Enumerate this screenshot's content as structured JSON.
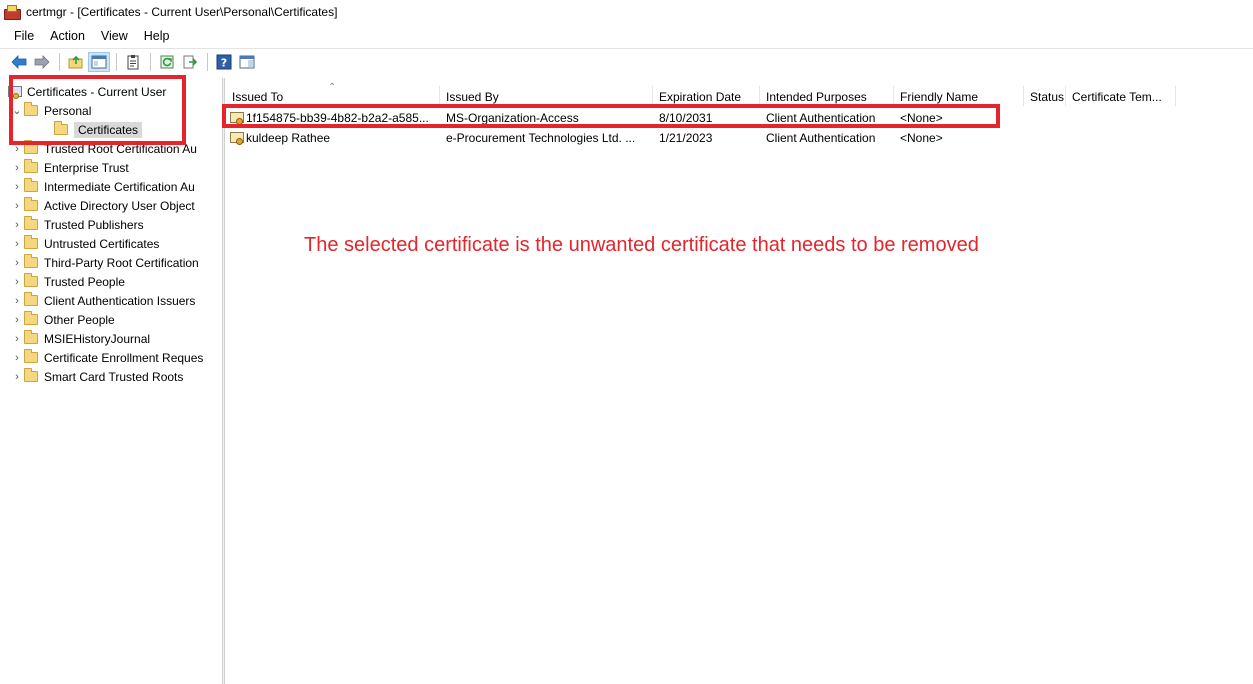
{
  "window": {
    "title": "certmgr - [Certificates - Current User\\Personal\\Certificates]"
  },
  "menu": [
    "File",
    "Action",
    "View",
    "Help"
  ],
  "toolbar": {
    "buttons": [
      "back-icon",
      "forward-icon",
      "up-folder-icon",
      "show-hide-tree-icon",
      "properties-icon",
      "refresh-icon",
      "export-list-icon",
      "help-icon",
      "action-pane-icon"
    ]
  },
  "tree": {
    "root": "Certificates - Current User",
    "items": [
      {
        "label": "Personal",
        "expanded": true
      },
      {
        "label": "Certificates",
        "selected": true
      },
      {
        "label": "Trusted Root Certification Au"
      },
      {
        "label": "Enterprise Trust"
      },
      {
        "label": "Intermediate Certification Au"
      },
      {
        "label": "Active Directory User Object"
      },
      {
        "label": "Trusted Publishers"
      },
      {
        "label": "Untrusted Certificates"
      },
      {
        "label": "Third-Party Root Certification"
      },
      {
        "label": "Trusted People"
      },
      {
        "label": "Client Authentication Issuers"
      },
      {
        "label": "Other People"
      },
      {
        "label": "MSIEHistoryJournal"
      },
      {
        "label": "Certificate Enrollment Reques"
      },
      {
        "label": "Smart Card Trusted Roots"
      }
    ]
  },
  "list": {
    "columns": [
      "Issued To",
      "Issued By",
      "Expiration Date",
      "Intended Purposes",
      "Friendly Name",
      "Status",
      "Certificate Tem..."
    ],
    "rows": [
      {
        "issued_to": "1f154875-bb39-4b82-b2a2-a585...",
        "issued_by": "MS-Organization-Access",
        "expiration": "8/10/2031",
        "purposes": "Client Authentication",
        "friendly": "<None>",
        "status": "",
        "template": ""
      },
      {
        "issued_to": "kuldeep Rathee",
        "issued_by": "e-Procurement Technologies Ltd. ...",
        "expiration": "1/21/2023",
        "purposes": "Client Authentication",
        "friendly": "<None>",
        "status": "",
        "template": ""
      }
    ]
  },
  "annotation": "The selected certificate is the unwanted certificate that needs to be removed",
  "colors": {
    "highlight": "#e5242b",
    "selection": "#d9d9d9"
  }
}
